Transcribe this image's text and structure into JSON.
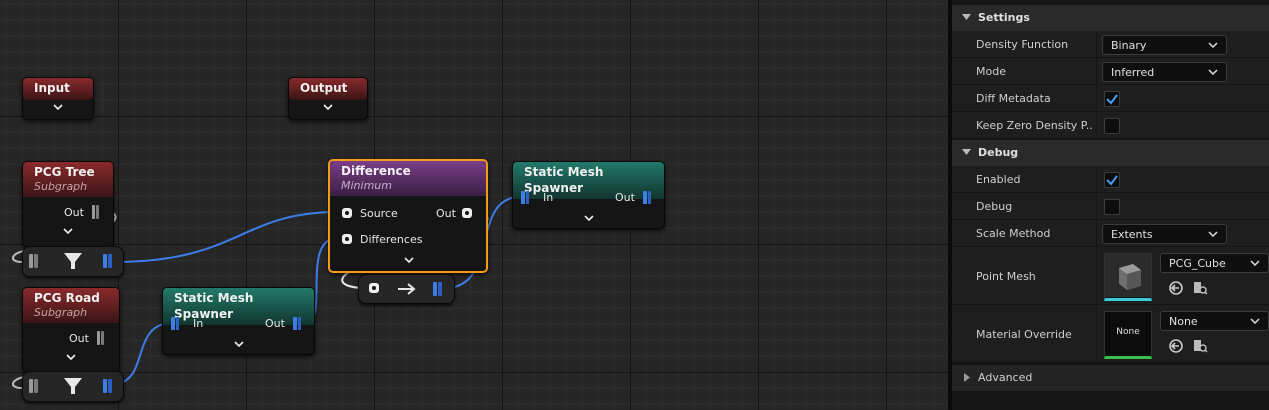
{
  "graph": {
    "nodes": {
      "input": {
        "title": "Input"
      },
      "output": {
        "title": "Output"
      },
      "pcg_tree": {
        "title": "PCG Tree",
        "subtitle": "Subgraph",
        "out_label": "Out"
      },
      "pcg_road": {
        "title": "PCG Road",
        "subtitle": "Subgraph",
        "out_label": "Out"
      },
      "difference": {
        "title": "Difference",
        "subtitle": "Minimum",
        "source_label": "Source",
        "differences_label": "Differences",
        "out_label": "Out"
      },
      "spawner_right": {
        "title": "Static Mesh Spawner",
        "in_label": "In",
        "out_label": "Out"
      },
      "spawner_bottom": {
        "title": "Static Mesh Spawner",
        "in_label": "In",
        "out_label": "Out"
      }
    },
    "colors": {
      "subgraph": "#8a2a2c",
      "spawner": "#227a6a",
      "difference": "#7a3e88",
      "selection": "#f39c18",
      "wire_blue": "#3d7de8",
      "wire_white": "#e8e8e8"
    }
  },
  "details": {
    "settings": {
      "title": "Settings",
      "density_function": {
        "label": "Density Function",
        "value": "Binary"
      },
      "mode": {
        "label": "Mode",
        "value": "Inferred"
      },
      "diff_metadata": {
        "label": "Diff Metadata",
        "checked": true
      },
      "keep_zero_density": {
        "label": "Keep Zero Density P...",
        "checked": false
      }
    },
    "debug": {
      "title": "Debug",
      "enabled": {
        "label": "Enabled",
        "checked": true
      },
      "debug": {
        "label": "Debug",
        "checked": false
      },
      "scale_method": {
        "label": "Scale Method",
        "value": "Extents"
      },
      "point_mesh": {
        "label": "Point Mesh",
        "value": "PCG_Cube"
      },
      "material_override": {
        "label": "Material Override",
        "value": "None",
        "thumb_text": "None"
      }
    },
    "advanced": {
      "title": "Advanced"
    }
  }
}
